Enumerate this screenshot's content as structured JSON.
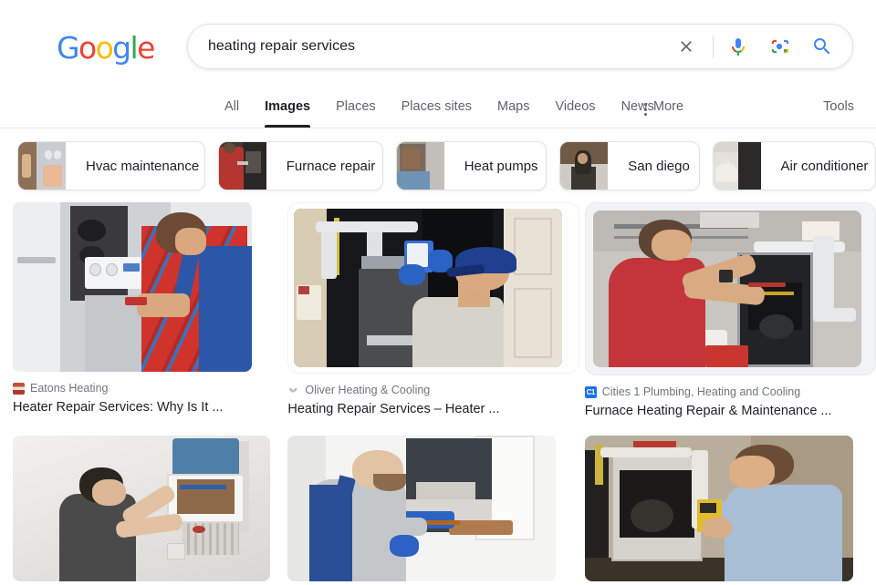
{
  "brand": {
    "logo_text": "Google",
    "logo_letters": [
      {
        "char": "G",
        "color": "#4285F4"
      },
      {
        "char": "o",
        "color": "#EA4335"
      },
      {
        "char": "o",
        "color": "#FBBC05"
      },
      {
        "char": "g",
        "color": "#4285F4"
      },
      {
        "char": "l",
        "color": "#34A853"
      },
      {
        "char": "e",
        "color": "#EA4335"
      }
    ]
  },
  "search": {
    "query": "heating repair services",
    "placeholder": "Search",
    "clear_icon": "close-icon",
    "mic_icon": "microphone-icon",
    "lens_icon": "google-lens-camera-icon",
    "search_icon": "search-icon"
  },
  "tabs": [
    {
      "label": "All",
      "active": false
    },
    {
      "label": "Images",
      "active": true
    },
    {
      "label": "Places",
      "active": false
    },
    {
      "label": "Places sites",
      "active": false
    },
    {
      "label": "Maps",
      "active": false
    },
    {
      "label": "Videos",
      "active": false
    },
    {
      "label": "News",
      "active": false
    }
  ],
  "more": {
    "label": "More",
    "icon": "more-vertical-icon"
  },
  "tools": {
    "label": "Tools"
  },
  "chips": [
    {
      "label": "Hvac maintenance",
      "thumb": "ct-a"
    },
    {
      "label": "Furnace repair",
      "thumb": "ct-b"
    },
    {
      "label": "Heat pumps",
      "thumb": "ct-c"
    },
    {
      "label": "San diego",
      "thumb": "ct-d"
    },
    {
      "label": "Air conditioner",
      "thumb": "ct-e"
    }
  ],
  "results": {
    "row1": [
      {
        "source": "Eatons Heating",
        "title": "Heater Repair Services: Why Is It ...",
        "favicon": "fav-eatons",
        "favicon_text": "",
        "state": "normal"
      },
      {
        "source": "Oliver Heating & Cooling",
        "title": "Heating Repair Services – Heater ...",
        "favicon": "fav-oliver",
        "favicon_text": "",
        "state": "framed"
      },
      {
        "source": "Cities 1 Plumbing, Heating and Cooling",
        "title": "Furnace Heating Repair & Maintenance ...",
        "favicon": "fav-c1",
        "favicon_text": "C1",
        "state": "selected"
      }
    ]
  },
  "colors": {
    "accent_blue": "#1a73e8",
    "text_primary": "#202124",
    "text_secondary": "#5f6368",
    "text_muted": "#70757a",
    "border": "#dfe1e5",
    "selected_bg": "#f1f3f4"
  }
}
